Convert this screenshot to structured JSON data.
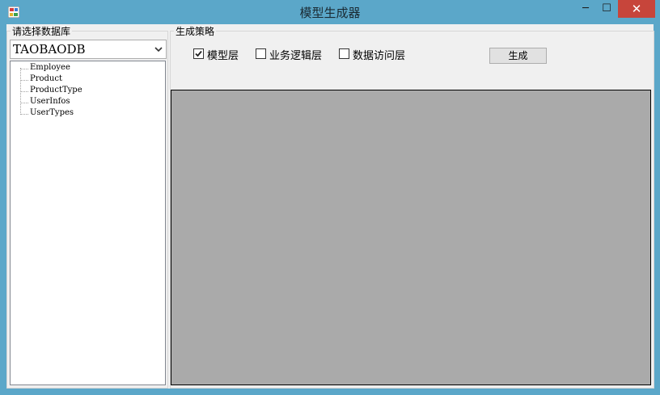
{
  "window": {
    "title": "模型生成器",
    "minimize_glyph": "─",
    "maximize_glyph": "☐",
    "close_glyph": "✕"
  },
  "database": {
    "group_label": "请选择数据库",
    "selected": "TAOBAODB",
    "tables": [
      "Employee",
      "Product",
      "ProductType",
      "UserInfos",
      "UserTypes"
    ]
  },
  "strategy": {
    "group_label": "生成策略",
    "options": [
      {
        "label": "模型层",
        "checked": true
      },
      {
        "label": "业务逻辑层",
        "checked": false
      },
      {
        "label": "数据访问层",
        "checked": false
      }
    ],
    "generate_label": "生成"
  },
  "colors": {
    "titlebar": "#5ba7c9",
    "close_button": "#c7453b",
    "output_area": "#aaaaaa"
  }
}
